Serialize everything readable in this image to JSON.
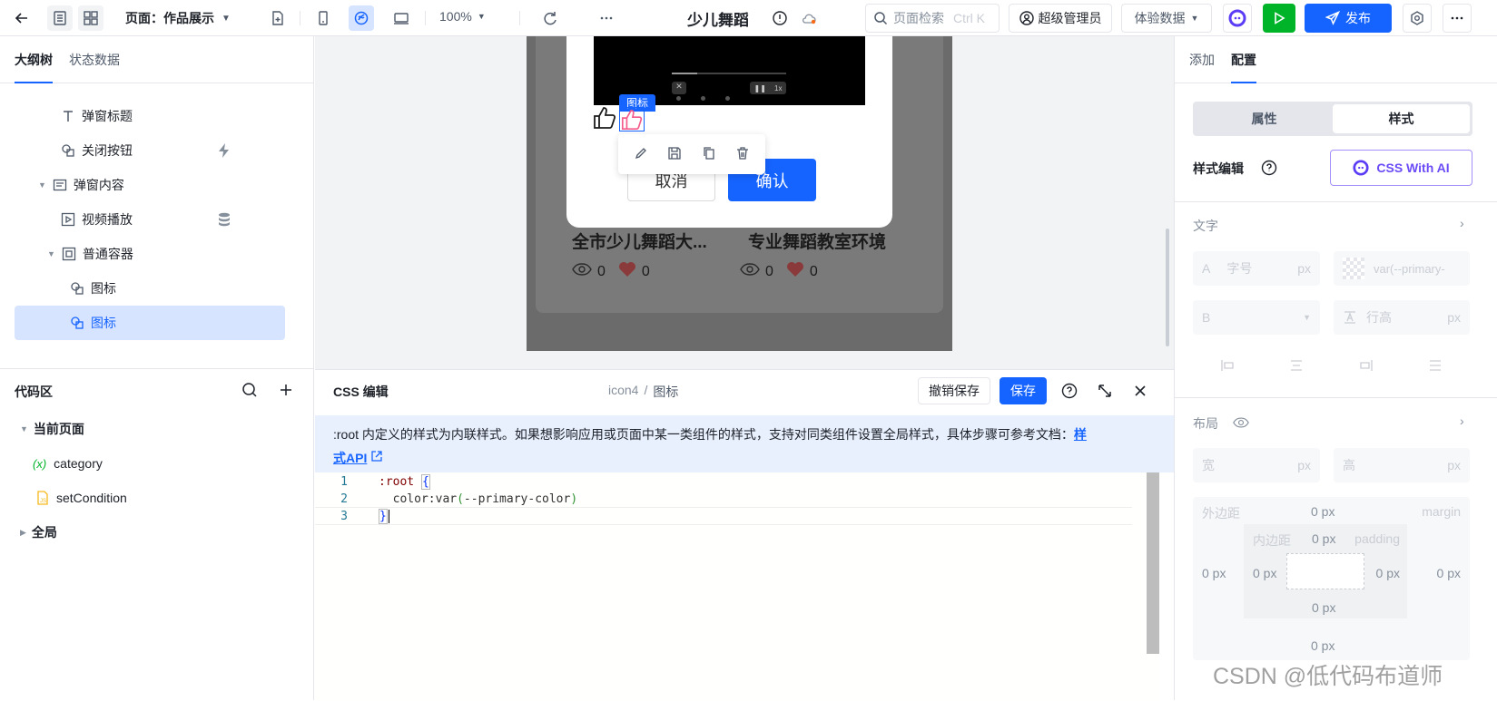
{
  "topbar": {
    "page_label": "页面：作品展示",
    "zoom": "100%",
    "app_title": "少儿舞蹈",
    "search_placeholder": "页面检索",
    "search_shortcut": "Ctrl K",
    "user": "超级管理员",
    "data_mode": "体验数据",
    "publish": "发布"
  },
  "left": {
    "tabs": [
      "大纲树",
      "状态数据"
    ],
    "tree": [
      {
        "label": "弹窗标题",
        "icon": "text-icon"
      },
      {
        "label": "关闭按钮",
        "icon": "shapes-icon"
      },
      {
        "label": "弹窗内容",
        "icon": "list-icon"
      },
      {
        "label": "视频播放",
        "icon": "video-icon"
      },
      {
        "label": "普通容器",
        "icon": "container-icon"
      },
      {
        "label": "图标",
        "icon": "shapes-icon"
      },
      {
        "label": "图标",
        "icon": "shapes-icon"
      }
    ],
    "code_title": "代码区",
    "code_tree": {
      "current_page": "当前页面",
      "category": "category",
      "var_symbol": "(x)",
      "set_condition": "setCondition",
      "global": "全局"
    }
  },
  "canvas": {
    "icon_tag": "图标",
    "cancel": "取消",
    "confirm": "确认",
    "card1_title": "全市少儿舞蹈大...",
    "card2_title": "专业舞蹈教室环境",
    "views": "0",
    "likes": "0",
    "video_speed": "1x"
  },
  "editor": {
    "title": "CSS 编辑",
    "crumb_id": "icon4",
    "crumb_sep": "/",
    "crumb_name": "图标",
    "revert": "撤销保存",
    "save": "保存",
    "notice": ":root 内定义的样式为内联样式。如果想影响应用或页面中某一类组件的样式，支持对同类组件设置全局样式，具体步骤可参考文档：",
    "notice_link_1": "样",
    "notice_link_2": "式API",
    "lines": [
      {
        "no": "1",
        "code": ":root {"
      },
      {
        "no": "2",
        "code": "  color:var(--primary-color)"
      },
      {
        "no": "3",
        "code": "}"
      }
    ]
  },
  "right": {
    "tabs": [
      "添加",
      "配置"
    ],
    "seg": [
      "属性",
      "样式"
    ],
    "style_edit": "样式编辑",
    "ai_btn": "CSS With AI",
    "text_section": "文字",
    "font_size_placeholder": "字号",
    "unit_px": "px",
    "color_value": "var(--primary-",
    "line_height_placeholder": "行高",
    "layout_section": "布局",
    "width": "宽",
    "height": "高",
    "margin_label": "外边距",
    "margin_en": "margin",
    "padding_label": "内边距",
    "padding_en": "padding",
    "zero_px": "0 px",
    "font_a": "A",
    "font_b": "B"
  },
  "watermark": "CSDN @低代码布道师"
}
